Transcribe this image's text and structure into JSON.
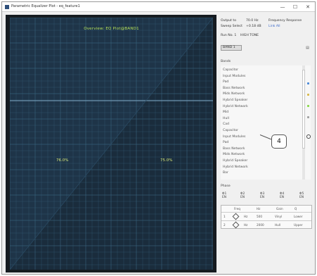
{
  "window": {
    "title": "Parametric Equalizer Plot - eq_feature1",
    "controls": {
      "minimize": "—",
      "maximize": "☐",
      "close": "✕"
    }
  },
  "plot": {
    "title": "Overview: EQ Plot@BAND1",
    "cursor_left": "76.0%",
    "cursor_right": "75.0%",
    "background": "#1e3448",
    "grid_color": "#3e6a86",
    "accent": "#b7e25a"
  },
  "side": {
    "output_label": "Output to",
    "output_value": "70.0 Hz",
    "frequency_label": "Frequency Response",
    "select_label": "Sweep Select",
    "select_value": "+0.18 dB",
    "select_link": "Link All",
    "run_label": "Run No. 1",
    "run_value": "HIGH TONE",
    "combo_value": "BAND 1",
    "combo_button": "▤",
    "section_bands": "Bands",
    "band_items": [
      "Capacitor",
      "Input Modules",
      "Pad",
      "Bass Network",
      "Mids Network",
      "Hybrid Speaker",
      "Hybrid Network",
      "Mid",
      "Hull",
      "Cad",
      "Capacitor",
      "Input Modules",
      "Pad",
      "Bass Network",
      "Mids Network",
      "Hybrid Speaker",
      "Hybrid Network",
      "Bar"
    ],
    "section_phase": "Phase",
    "checks": [
      "Φ1\nEN",
      "Φ2\nEN",
      "Φ3\nEN",
      "Φ4\nEN",
      "Φ5\nEN"
    ],
    "table": {
      "headers": [
        "Freq",
        "Hz",
        "Gain",
        "Q"
      ],
      "row1": [
        "1",
        "Hz",
        "500",
        "Vinyl",
        "Lower"
      ],
      "row2": [
        "2",
        "Hz",
        "2000",
        "Hull",
        "Upper"
      ]
    }
  },
  "callout": "4",
  "rail_colors": [
    "#4a8ad8",
    "#d8b94a",
    "#8ad84a",
    "#a0a0a0"
  ]
}
